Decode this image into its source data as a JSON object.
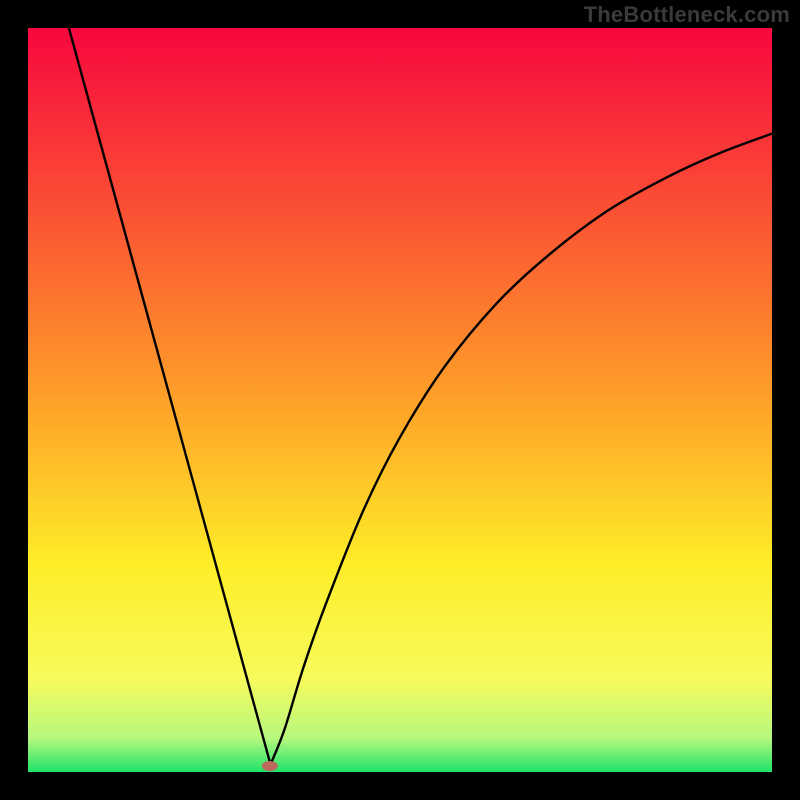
{
  "watermark": "TheBottleneck.com",
  "chart_data": {
    "type": "line",
    "title": "",
    "xlabel": "",
    "ylabel": "",
    "xlim": [
      0,
      100
    ],
    "ylim": [
      0,
      100
    ],
    "grid": false,
    "curve_description": "V-shaped bottleneck curve: steep linear descent from top-left to a minimum near x≈32%, then asymptotic rise toward top-right",
    "minimum_x_fraction": 0.325,
    "background_gradient": {
      "type": "vertical",
      "stops": [
        {
          "pos": 0.0,
          "color": "#f7073f"
        },
        {
          "pos": 0.28,
          "color": "#fb5b32"
        },
        {
          "pos": 0.52,
          "color": "#fea728"
        },
        {
          "pos": 0.72,
          "color": "#feed28"
        },
        {
          "pos": 0.875,
          "color": "#f7fb5c"
        },
        {
          "pos": 0.955,
          "color": "#b6f87e"
        },
        {
          "pos": 1.0,
          "color": "#1ee269"
        }
      ]
    },
    "marker": {
      "x_fraction": 0.325,
      "y_fraction": 0.992,
      "color": "#bb6a5d"
    },
    "series": [
      {
        "name": "left-branch",
        "points": [
          {
            "x": 0.055,
            "y": 0.0
          },
          {
            "x": 0.326,
            "y": 0.99
          }
        ]
      },
      {
        "name": "right-branch",
        "points": [
          {
            "x": 0.326,
            "y": 0.99
          },
          {
            "x": 0.345,
            "y": 0.942
          },
          {
            "x": 0.37,
            "y": 0.86
          },
          {
            "x": 0.4,
            "y": 0.775
          },
          {
            "x": 0.45,
            "y": 0.65
          },
          {
            "x": 0.5,
            "y": 0.55
          },
          {
            "x": 0.56,
            "y": 0.455
          },
          {
            "x": 0.63,
            "y": 0.37
          },
          {
            "x": 0.7,
            "y": 0.305
          },
          {
            "x": 0.78,
            "y": 0.245
          },
          {
            "x": 0.86,
            "y": 0.2
          },
          {
            "x": 0.93,
            "y": 0.168
          },
          {
            "x": 1.0,
            "y": 0.142
          }
        ]
      }
    ]
  }
}
